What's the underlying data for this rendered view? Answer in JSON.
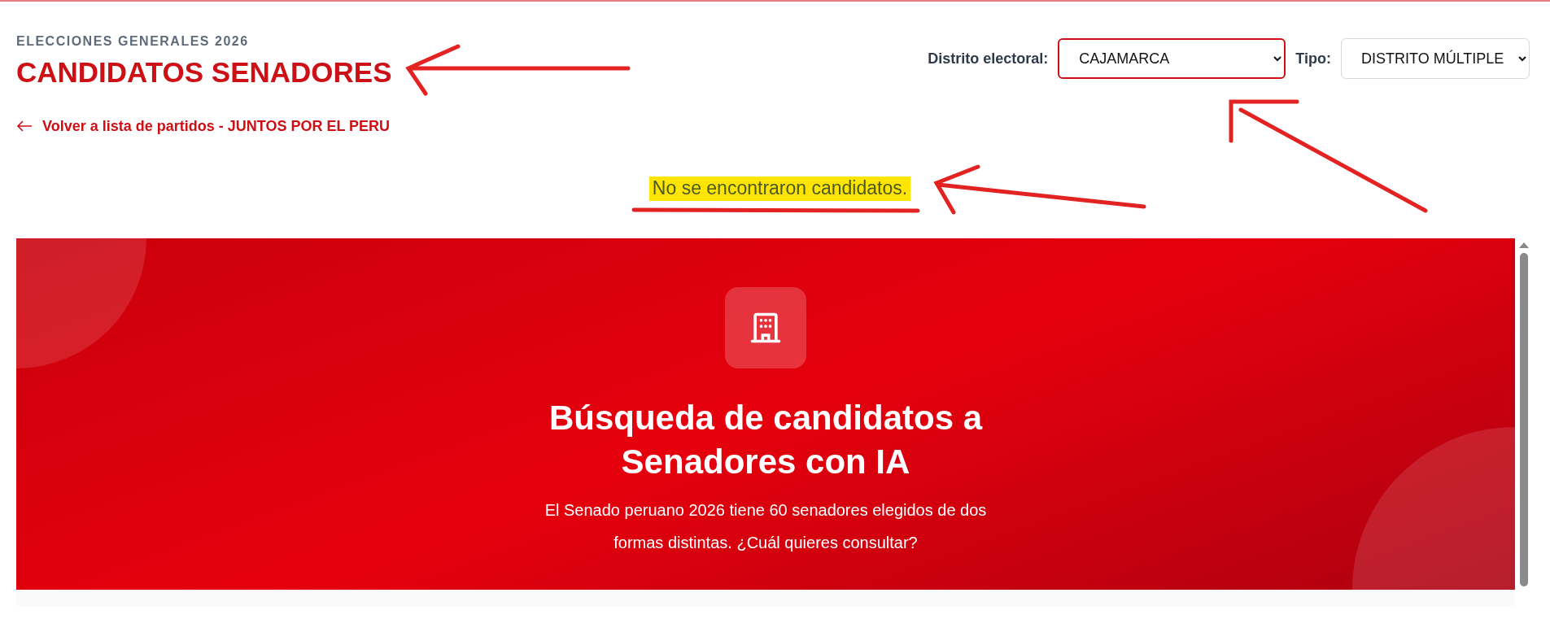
{
  "header": {
    "eyebrow": "ELECCIONES GENERALES 2026",
    "title": "CANDIDATOS SENADORES",
    "back_link": "Volver a lista de partidos - JUNTOS POR EL PERU"
  },
  "filters": [
    {
      "label": "Distrito electoral:",
      "value": "CAJAMARCA",
      "focused": true
    },
    {
      "label": "Tipo:",
      "value": "DISTRITO MÚLTIPLE",
      "focused": false
    }
  ],
  "message": {
    "text": "No se encontraron candidatos.",
    "highlighted": true
  },
  "banner": {
    "title": "Búsqueda de candidatos a Senadores con IA",
    "description": "El Senado peruano 2026 tiene 60 senadores elegidos de dos formas distintas. ¿Cuál quieres consultar?"
  }
}
